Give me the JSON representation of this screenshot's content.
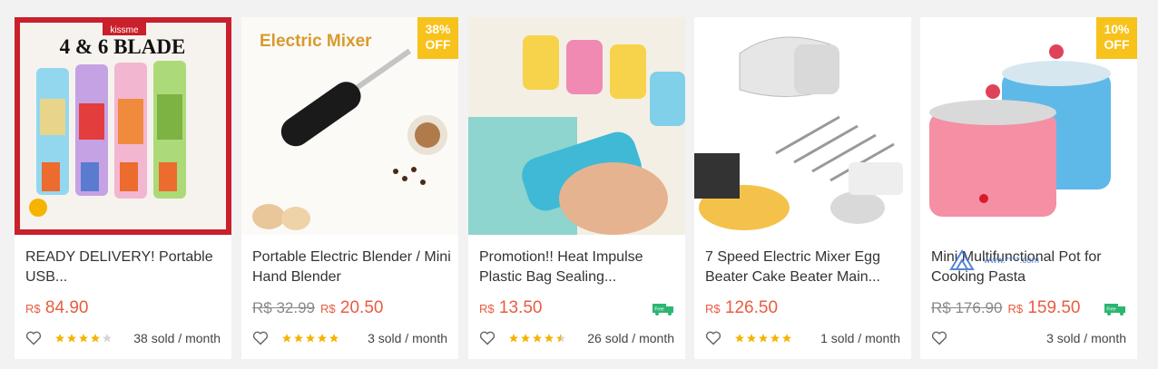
{
  "products": [
    {
      "title": "READY DELIVERY! Portable USB...",
      "image_label": "4 & 6 BLADE",
      "image_brand": "kissme",
      "currency": "R$",
      "price": "84.90",
      "old_price": "",
      "badge": "",
      "rating": 4,
      "sold": "38 sold / month",
      "free_shipping": false
    },
    {
      "title": "Portable Electric Blender / Mini Hand Blender",
      "image_label": "Electric Mixer",
      "currency": "R$",
      "price": "20.50",
      "old_price": "R$ 32.99",
      "badge": "38% OFF",
      "badge_line1": "38%",
      "badge_line2": "OFF",
      "rating": 5,
      "sold": "3 sold / month",
      "free_shipping": false
    },
    {
      "title": "Promotion!! Heat Impulse Plastic Bag Sealing...",
      "currency": "R$",
      "price": "13.50",
      "old_price": "",
      "badge": "",
      "rating": 4.5,
      "sold": "26 sold / month",
      "free_shipping": true
    },
    {
      "title": "7 Speed Electric Mixer Egg Beater Cake Beater Main...",
      "currency": "R$",
      "price": "126.50",
      "old_price": "",
      "badge": "",
      "rating": 5,
      "sold": "1 sold / month",
      "free_shipping": false
    },
    {
      "title": "Mini Multifunctional Pot for Cooking Pasta",
      "currency": "R$",
      "price": "159.50",
      "old_price": "R$ 176.90",
      "badge": "10% OFF",
      "badge_line1": "10%",
      "badge_line2": "OFF",
      "rating": 0,
      "sold": "3 sold / month",
      "free_shipping": true
    }
  ],
  "free_shipping_label": "Free",
  "colors": {
    "price": "#e85c41",
    "badge": "#f7c21b",
    "star": "#f5b301",
    "free_shipping": "#2bb673"
  },
  "watermark": {
    "text": "www.****.com"
  }
}
